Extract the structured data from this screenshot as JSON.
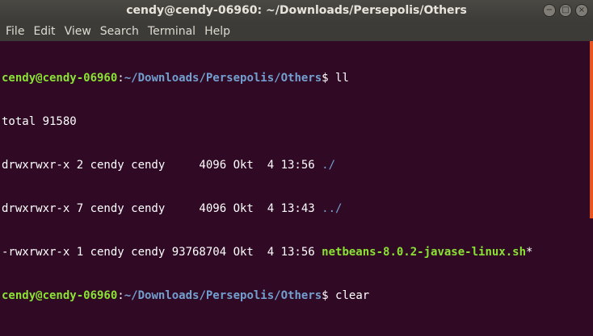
{
  "window": {
    "title": "cendy@cendy-06960: ~/Downloads/Persepolis/Others",
    "buttons": {
      "minimize": "−",
      "maximize": "□",
      "close": "×"
    }
  },
  "menu": [
    "File",
    "Edit",
    "View",
    "Search",
    "Terminal",
    "Help"
  ],
  "terminal": {
    "prompt_user": "cendy@cendy-06960",
    "prompt_sep": ":",
    "prompt_path": "~/Downloads/Persepolis/Others",
    "prompt_end": "$ ",
    "lines": [
      {
        "kind": "cmd",
        "text": "ll"
      },
      {
        "kind": "text",
        "text": "total 91580"
      },
      {
        "kind": "ls",
        "meta": "drwxrwxr-x 2 cendy cendy     4096 Okt  4 13:56 ",
        "name": "./",
        "type": "dir"
      },
      {
        "kind": "ls",
        "meta": "drwxrwxr-x 7 cendy cendy     4096 Okt  4 13:43 ",
        "name": "../",
        "type": "dir"
      },
      {
        "kind": "ls",
        "meta": "-rwxrwxr-x 1 cendy cendy 93768704 Okt  4 13:56 ",
        "name": "netbeans-8.0.2-javase-linux.sh",
        "suffix": "*",
        "type": "exec"
      },
      {
        "kind": "cmd",
        "text": "clear"
      }
    ]
  },
  "colors": {
    "background": "#300a24",
    "prompt_user": "#8ae234",
    "prompt_path": "#729fcf",
    "scrollbar": "#e95420"
  }
}
